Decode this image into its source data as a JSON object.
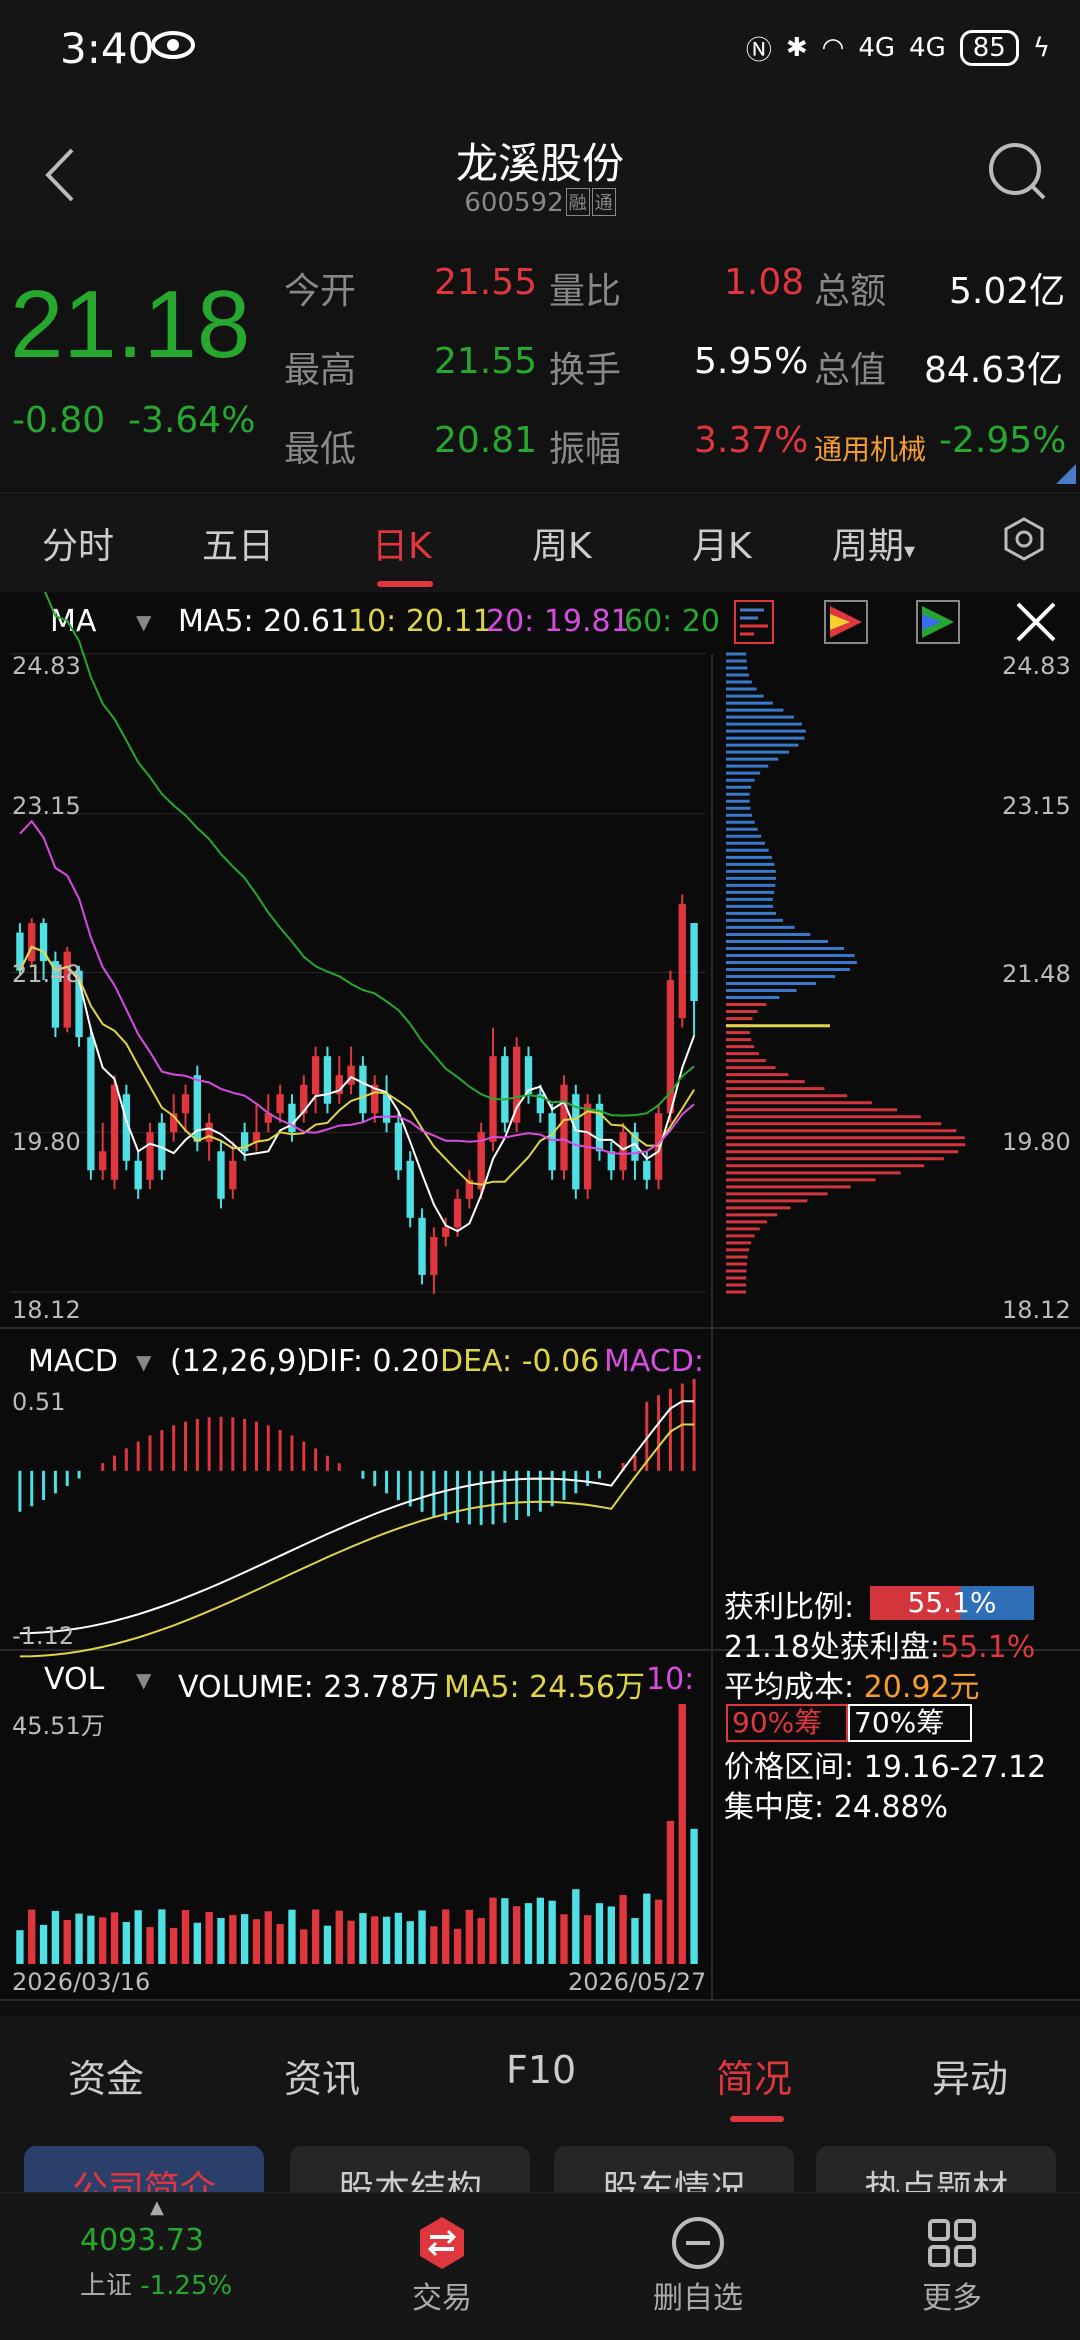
{
  "status_bar": {
    "time": "3:40",
    "battery": "85",
    "network": "4G"
  },
  "header": {
    "title": "龙溪股份",
    "code": "600592",
    "tags": [
      "融",
      "通"
    ]
  },
  "quote": {
    "price": "21.18",
    "change": "-0.80",
    "change_pct": "-3.64%",
    "rows": [
      {
        "l1": "今开",
        "v1": "21.55",
        "l2": "量比",
        "v2": "1.08",
        "l3": "总额",
        "v3": "5.02亿"
      },
      {
        "l1": "最高",
        "v1": "21.55",
        "l2": "换手",
        "v2": "5.95%",
        "l3": "总值",
        "v3": "84.63亿"
      },
      {
        "l1": "最低",
        "v1": "20.81",
        "l2": "振幅",
        "v2": "3.37%",
        "l3": "通用机械",
        "v3": "-2.95%"
      }
    ]
  },
  "period_tabs": [
    "分时",
    "五日",
    "日K",
    "周K",
    "月K",
    "周期"
  ],
  "active_period": "日K",
  "ma_legend": {
    "name": "MA",
    "ma5": "MA5: 20.61",
    "ma10": "10: 20.11",
    "ma20": "20: 19.81",
    "ma60": "60: 20"
  },
  "price_axis": [
    "24.83",
    "23.15",
    "21.48",
    "19.80",
    "18.12"
  ],
  "macd_legend": {
    "name": "MACD",
    "params": "(12,26,9)",
    "dif": "DIF: 0.20",
    "dea": "DEA: -0.06",
    "macd": "MACD:"
  },
  "macd_axis": [
    "0.51",
    "-1.12"
  ],
  "vol_legend": {
    "name": "VOL",
    "volume": "VOLUME: 23.78万",
    "ma5": "MA5: 24.56万",
    "ma10": "10:"
  },
  "vol_axis": "45.51万",
  "dates": {
    "start": "2026/03/16",
    "end": "2026/05/27"
  },
  "chips": {
    "profit_ratio_label": "获利比例:",
    "profit_ratio_value": "55.1%",
    "profit_at_label": "21.18处获利盘:",
    "profit_at_value": "55.1%",
    "avg_cost_label": "平均成本:",
    "avg_cost_value": "20.92元",
    "chip90": "90%筹",
    "chip70": "70%筹",
    "range_label": "价格区间:",
    "range_value": "19.16-27.12",
    "concentration_label": "集中度:",
    "concentration_value": "24.88%"
  },
  "bottom_tabs": [
    "资金",
    "资讯",
    "F10",
    "简况",
    "异动"
  ],
  "active_bottom_tab": "简况",
  "sub_tabs": [
    "公司简介",
    "股本结构",
    "股东情况",
    "热点题材"
  ],
  "bottom_bar": {
    "index_value": "4093.73",
    "index_name": "上证",
    "index_change": "-1.25%",
    "trade": "交易",
    "remove": "删自选",
    "more": "更多"
  },
  "colors": {
    "up": "#e0363e",
    "down": "#26a82e",
    "candle_down": "#4fe0e6",
    "accent": "#e0363e"
  },
  "candles": [
    [
      21.9,
      21.5,
      22.0,
      21.45
    ],
    [
      21.6,
      22.0,
      22.05,
      21.55
    ],
    [
      22.0,
      21.6,
      22.05,
      21.4
    ],
    [
      21.6,
      20.9,
      21.7,
      20.8
    ],
    [
      20.9,
      21.7,
      21.75,
      20.85
    ],
    [
      21.5,
      20.8,
      21.55,
      20.7
    ],
    [
      20.8,
      19.4,
      20.9,
      19.3
    ],
    [
      19.4,
      19.6,
      19.9,
      19.3
    ],
    [
      19.3,
      20.3,
      20.4,
      19.2
    ],
    [
      20.2,
      19.5,
      20.3,
      19.4
    ],
    [
      19.5,
      19.2,
      19.6,
      19.1
    ],
    [
      19.3,
      19.8,
      19.9,
      19.2
    ],
    [
      19.9,
      19.4,
      20.0,
      19.3
    ],
    [
      19.8,
      20.0,
      20.2,
      19.7
    ],
    [
      20.0,
      20.2,
      20.3,
      19.8
    ],
    [
      20.4,
      19.7,
      20.5,
      19.6
    ],
    [
      19.7,
      19.9,
      20.0,
      19.5
    ],
    [
      19.6,
      19.1,
      19.7,
      19.0
    ],
    [
      19.2,
      19.5,
      19.7,
      19.1
    ],
    [
      19.8,
      19.6,
      19.9,
      19.5
    ],
    [
      19.7,
      19.8,
      20.1,
      19.6
    ],
    [
      19.9,
      20.0,
      20.2,
      19.8
    ],
    [
      20.0,
      20.2,
      20.3,
      19.9
    ],
    [
      20.1,
      19.8,
      20.2,
      19.7
    ],
    [
      20.0,
      20.3,
      20.4,
      19.9
    ],
    [
      20.2,
      20.6,
      20.7,
      20.0
    ],
    [
      20.6,
      20.1,
      20.7,
      20.0
    ],
    [
      20.2,
      20.4,
      20.6,
      20.1
    ],
    [
      20.3,
      20.5,
      20.7,
      20.2
    ],
    [
      20.5,
      20.0,
      20.6,
      19.9
    ],
    [
      20.0,
      20.3,
      20.4,
      19.9
    ],
    [
      20.2,
      19.9,
      20.4,
      19.8
    ],
    [
      19.9,
      19.4,
      20.0,
      19.3
    ],
    [
      19.5,
      18.9,
      19.6,
      18.8
    ],
    [
      18.9,
      18.3,
      19.0,
      18.2
    ],
    [
      18.3,
      18.7,
      18.8,
      18.1
    ],
    [
      18.7,
      18.8,
      18.9,
      18.6
    ],
    [
      18.8,
      19.1,
      19.2,
      18.7
    ],
    [
      19.1,
      19.3,
      19.4,
      19.0
    ],
    [
      19.2,
      19.8,
      19.9,
      19.1
    ],
    [
      19.7,
      20.6,
      20.9,
      19.6
    ],
    [
      20.6,
      19.9,
      20.7,
      19.8
    ],
    [
      19.9,
      20.7,
      20.8,
      19.8
    ],
    [
      20.6,
      20.2,
      20.7,
      20.1
    ],
    [
      20.2,
      20.0,
      20.3,
      19.9
    ],
    [
      20.0,
      19.4,
      20.1,
      19.3
    ],
    [
      19.4,
      20.3,
      20.4,
      19.3
    ],
    [
      20.2,
      19.2,
      20.3,
      19.1
    ],
    [
      19.2,
      20.1,
      20.2,
      19.1
    ],
    [
      20.1,
      19.6,
      20.2,
      19.5
    ],
    [
      19.6,
      19.4,
      19.7,
      19.3
    ],
    [
      19.4,
      19.8,
      19.9,
      19.3
    ],
    [
      19.8,
      19.5,
      19.9,
      19.3
    ],
    [
      19.5,
      19.3,
      19.6,
      19.2
    ],
    [
      19.3,
      20.0,
      20.1,
      19.2
    ],
    [
      20.0,
      21.4,
      21.5,
      19.9
    ],
    [
      21.0,
      22.2,
      22.3,
      20.9
    ],
    [
      22.0,
      21.18,
      22.0,
      20.81
    ]
  ]
}
